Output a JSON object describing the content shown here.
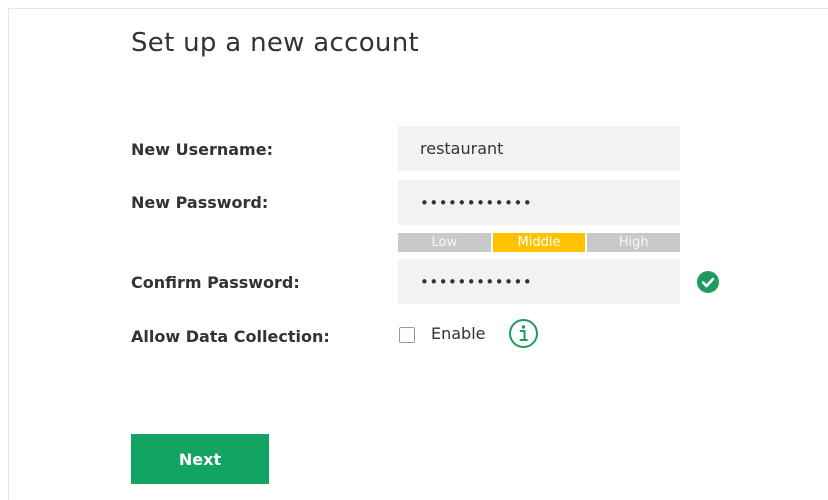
{
  "page": {
    "title": "Set up a new account"
  },
  "form": {
    "username": {
      "label": "New Username:",
      "value": "restaurant"
    },
    "password": {
      "label": "New Password:",
      "value": "••••••••••••"
    },
    "strength": {
      "levels": [
        "Low",
        "Middle",
        "High"
      ],
      "selected": "Middle",
      "active_color": "#ffc200",
      "inactive_color": "#c9c9c9"
    },
    "confirm": {
      "label": "Confirm Password:",
      "value": "••••••••••••",
      "status_icon": "check-circle-icon",
      "status_color": "#1e9b5f"
    },
    "data_collection": {
      "label": "Allow Data Collection:",
      "checkbox_label": "Enable",
      "checked": false,
      "info_icon": "info-circle-icon",
      "info_color": "#1e9b5f"
    }
  },
  "actions": {
    "next_label": "Next",
    "next_color": "#12a463"
  }
}
